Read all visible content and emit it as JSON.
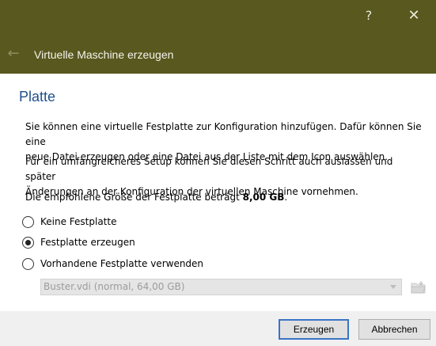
{
  "window": {
    "help_glyph": "?",
    "close_glyph": "✕",
    "back_glyph": "←",
    "title": "Virtuelle Maschine erzeugen",
    "titlebar_color": "#58581f"
  },
  "page": {
    "heading": "Platte",
    "paragraph1_line1": "Sie können eine virtuelle Festplatte zur Konfiguration hinzufügen. Dafür können Sie eine",
    "paragraph1_line2": "neue Datei erzeugen oder eine Datei aus der Liste mit dem Icon auswählen.",
    "paragraph2_line1": "Für ein umfangreicheres Setup können Sie diesen Schritt auch auslassen und später",
    "paragraph2_line2": "Änderungen an der Konfiguration der virtuellen Maschine vornehmen.",
    "recommended_prefix": "Die empfohlene Größe der Festplatte beträgt ",
    "recommended_size": "8,00 GB",
    "recommended_suffix": "."
  },
  "options": [
    {
      "label": "Keine Festplatte",
      "checked": false
    },
    {
      "label": "Festplatte erzeugen",
      "checked": true
    },
    {
      "label": "Vorhandene Festplatte verwenden",
      "checked": false
    }
  ],
  "disk_select": {
    "value": "Buster.vdi (normal, 64,00 GB)",
    "enabled": false
  },
  "buttons": {
    "create": "Erzeugen",
    "cancel": "Abbrechen"
  }
}
